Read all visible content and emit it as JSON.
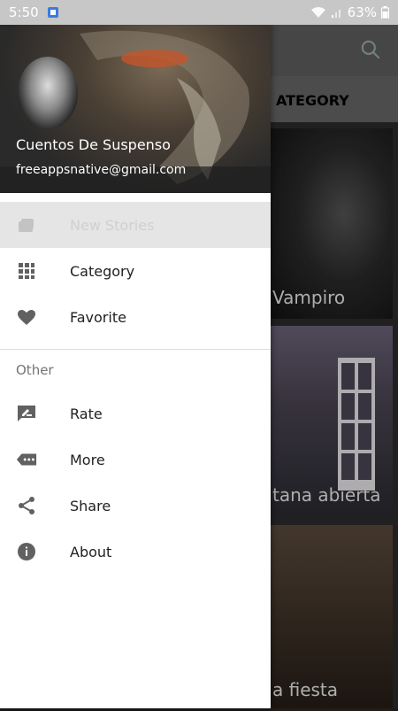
{
  "status_bar": {
    "time": "5:50",
    "battery": "63%"
  },
  "background": {
    "section_title": "ATEGORY",
    "cards": [
      {
        "label": "Vampiro"
      },
      {
        "label": "tana abierta"
      },
      {
        "label": "a fiesta"
      }
    ]
  },
  "drawer": {
    "app_name": "Cuentos De Suspenso",
    "email": "freeappsnative@gmail.com",
    "items": [
      {
        "label": "New Stories",
        "icon": "stack-icon",
        "selected": true
      },
      {
        "label": "Category",
        "icon": "grid-icon"
      },
      {
        "label": "Favorite",
        "icon": "heart-icon"
      }
    ],
    "other_header": "Other",
    "other_items": [
      {
        "label": "Rate",
        "icon": "rate-icon"
      },
      {
        "label": "More",
        "icon": "more-icon"
      },
      {
        "label": "Share",
        "icon": "share-icon"
      },
      {
        "label": "About",
        "icon": "info-icon"
      }
    ]
  },
  "colors": {
    "drawer_bg": "#ffffff",
    "icon_gray": "#616161",
    "selected_bg": "#e5e5e5"
  }
}
